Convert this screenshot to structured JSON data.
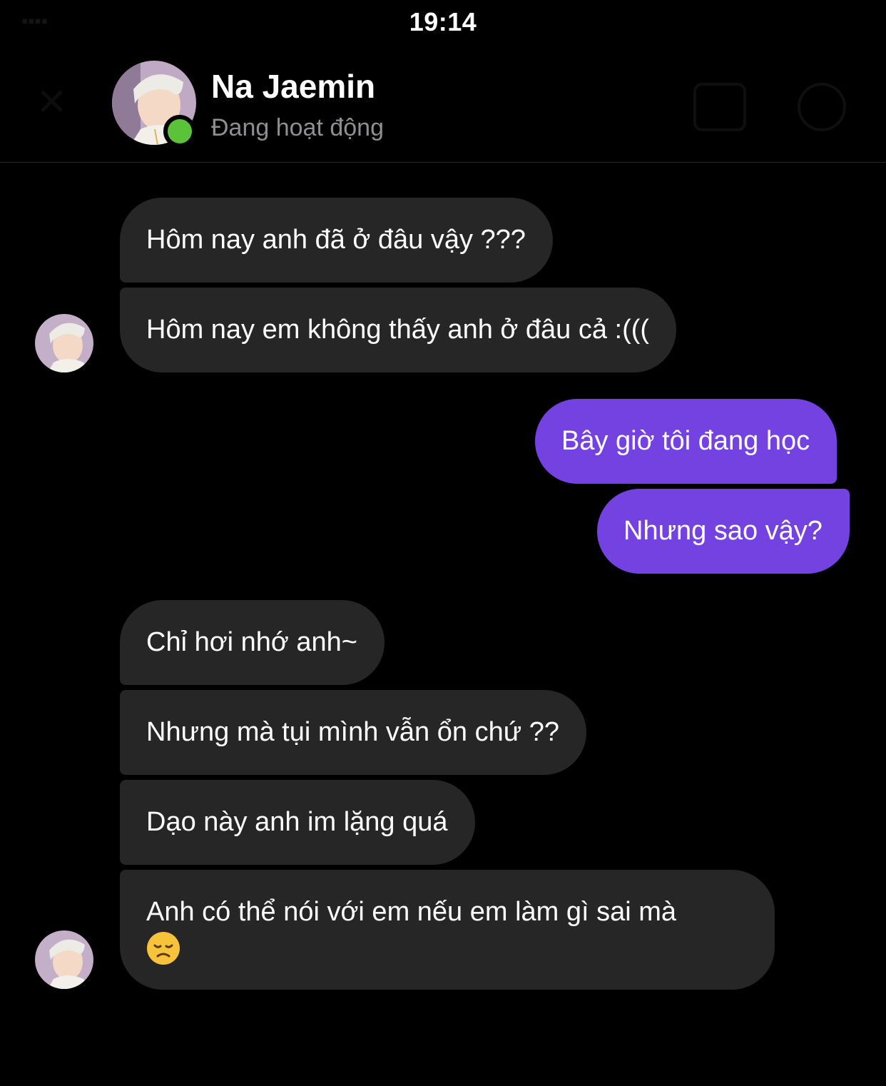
{
  "status_bar": {
    "time": "19:14"
  },
  "header": {
    "contact_name": "Na Jaemin",
    "contact_status": "Đang hoạt động",
    "online_color": "#5ac33a",
    "icons": [
      "back-icon",
      "avatar",
      "video-call-icon",
      "info-icon"
    ]
  },
  "colors": {
    "background": "#000000",
    "incoming_bubble": "#262626",
    "outgoing_bubble": "#7542e2",
    "secondary_text": "#8e8e93"
  },
  "messages": [
    {
      "sender": "contact",
      "text": "Hôm nay anh đã ở đâu vậy ???"
    },
    {
      "sender": "contact",
      "text": "Hôm nay em không thấy anh ở đâu cả :((("
    },
    {
      "sender": "me",
      "text": "Bây giờ tôi đang học"
    },
    {
      "sender": "me",
      "text": "Nhưng sao vậy?"
    },
    {
      "sender": "contact",
      "text": "Chỉ hơi nhớ anh~"
    },
    {
      "sender": "contact",
      "text": "Nhưng mà tụi mình vẫn ổn chứ ??"
    },
    {
      "sender": "contact",
      "text": "Dạo này anh im lặng quá"
    },
    {
      "sender": "contact",
      "text": "Anh có thể nói với em nếu em làm gì sai mà",
      "emoji": "disappointed-face-icon"
    }
  ]
}
